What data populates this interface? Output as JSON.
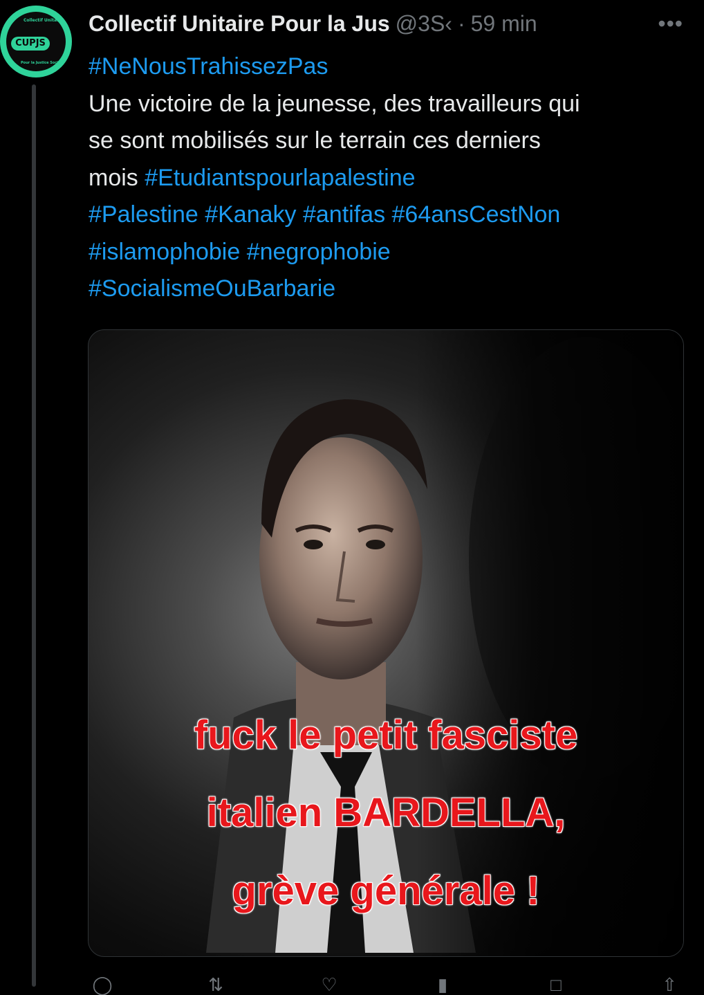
{
  "tweet": {
    "author_name": "Collectif Unitaire Pour la Jus",
    "handle": "@3S‹",
    "separator": "·",
    "time": "59 min",
    "more": "•••",
    "avatar": {
      "ring_top": "Collectif Unitaire",
      "badge": "CUPJS",
      "ring_bottom": "Pour la Justice Sociale"
    },
    "text_lines": [
      [
        {
          "t": "#NeNousTrahissezPas",
          "tag": true
        }
      ],
      [
        {
          "t": "Une victoire de la jeunesse, des travailleurs qui",
          "tag": false
        }
      ],
      [
        {
          "t": "se sont mobilisés sur le terrain ces derniers",
          "tag": false
        }
      ],
      [
        {
          "t": "mois ",
          "tag": false
        },
        {
          "t": "#Etudiantspourlapalestine",
          "tag": true
        }
      ],
      [
        {
          "t": "#Palestine #Kanaky #antifas #64ansCestNon",
          "tag": true
        }
      ],
      [
        {
          "t": "#islamophobie #negrophobie",
          "tag": true
        }
      ],
      [
        {
          "t": "#SocialismeOuBarbarie",
          "tag": true
        }
      ]
    ],
    "image_caption": [
      "fuck le petit fasciste",
      "italien BARDELLA,",
      "grève générale !"
    ],
    "actions": [
      "reply-icon",
      "retweet-icon",
      "like-icon",
      "views-icon",
      "bookmark-icon",
      "share-icon"
    ]
  },
  "colors": {
    "background": "#000000",
    "text": "#e7e9ea",
    "muted": "#71767b",
    "hashtag": "#1d9bf0",
    "avatar_green": "#2fd39a",
    "caption_red": "#e8171c"
  }
}
